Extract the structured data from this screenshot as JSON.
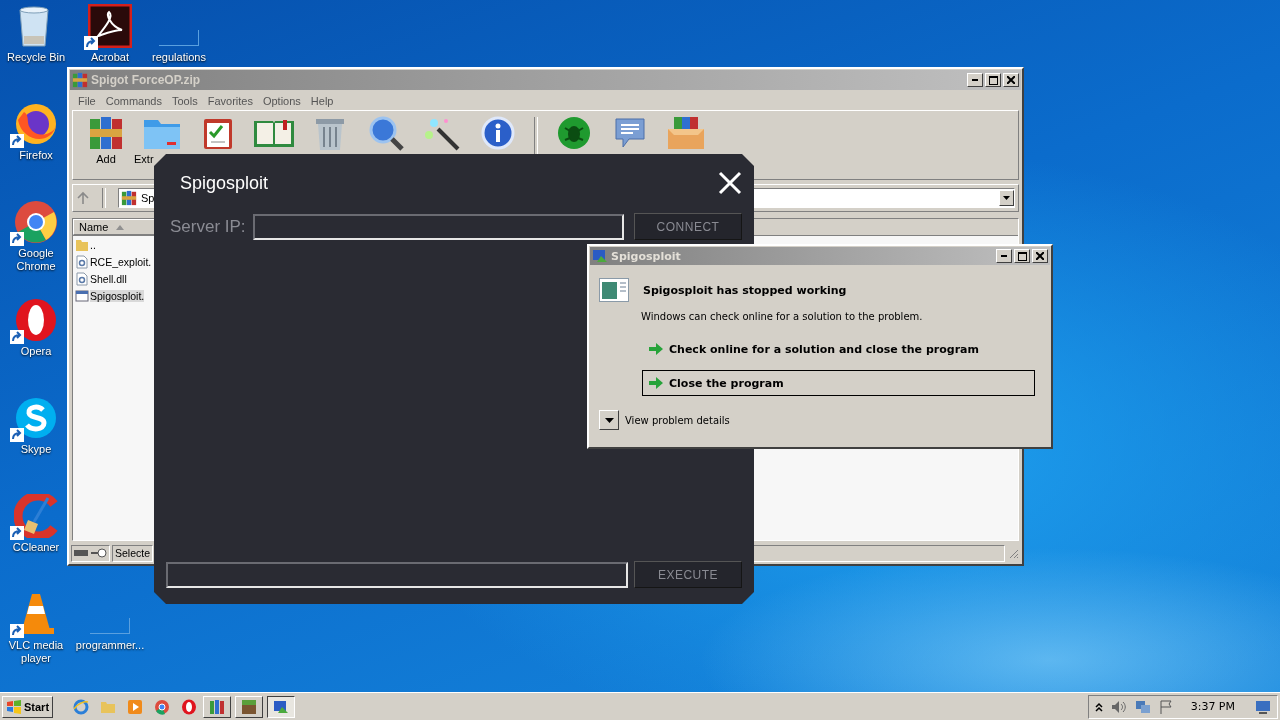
{
  "desktop_icons": [
    {
      "label": "Recycle Bin",
      "kind": "recycle"
    },
    {
      "label": "Acrobat",
      "kind": "acrobat"
    },
    {
      "label": "regulations",
      "kind": "blank"
    },
    {
      "label": "Firefox",
      "kind": "firefox"
    },
    {
      "label": "Google Chrome",
      "kind": "chrome"
    },
    {
      "label": "Opera",
      "kind": "opera"
    },
    {
      "label": "Skype",
      "kind": "skype"
    },
    {
      "label": "CCleaner",
      "kind": "ccleaner"
    },
    {
      "label": "VLC media player",
      "kind": "vlc"
    },
    {
      "label": "programmer...",
      "kind": "blank"
    }
  ],
  "archiver": {
    "title": "Spigot ForceOP.zip",
    "menu": [
      "File",
      "Commands",
      "Tools",
      "Favorites",
      "Options",
      "Help"
    ],
    "toolbar": [
      {
        "label": "Add"
      },
      {
        "label": "Extr"
      }
    ],
    "address": "Sp",
    "columns": [
      "Name"
    ],
    "files": [
      {
        "name": "..",
        "kind": "folder",
        "selected": false
      },
      {
        "name": "RCE_exploit.",
        "kind": "dll",
        "selected": false
      },
      {
        "name": "Shell.dll",
        "kind": "dll",
        "selected": false
      },
      {
        "name": "Spigosploit.",
        "kind": "exe",
        "selected": true
      }
    ],
    "status": "Selecte"
  },
  "app": {
    "title": "Spigosploit",
    "server_label": "Server IP:",
    "connect": "CONNECT",
    "execute": "EXECUTE"
  },
  "error_dialog": {
    "title": "Spigosploit",
    "heading": "Spigosploit has stopped working",
    "message": "Windows can check online for a solution to the problem.",
    "options": [
      {
        "label": "Check online for a solution and close the program",
        "selected": false
      },
      {
        "label": "Close the program",
        "selected": true
      }
    ],
    "details": "View problem details"
  },
  "taskbar": {
    "start": "Start",
    "clock": "3:37 PM"
  }
}
